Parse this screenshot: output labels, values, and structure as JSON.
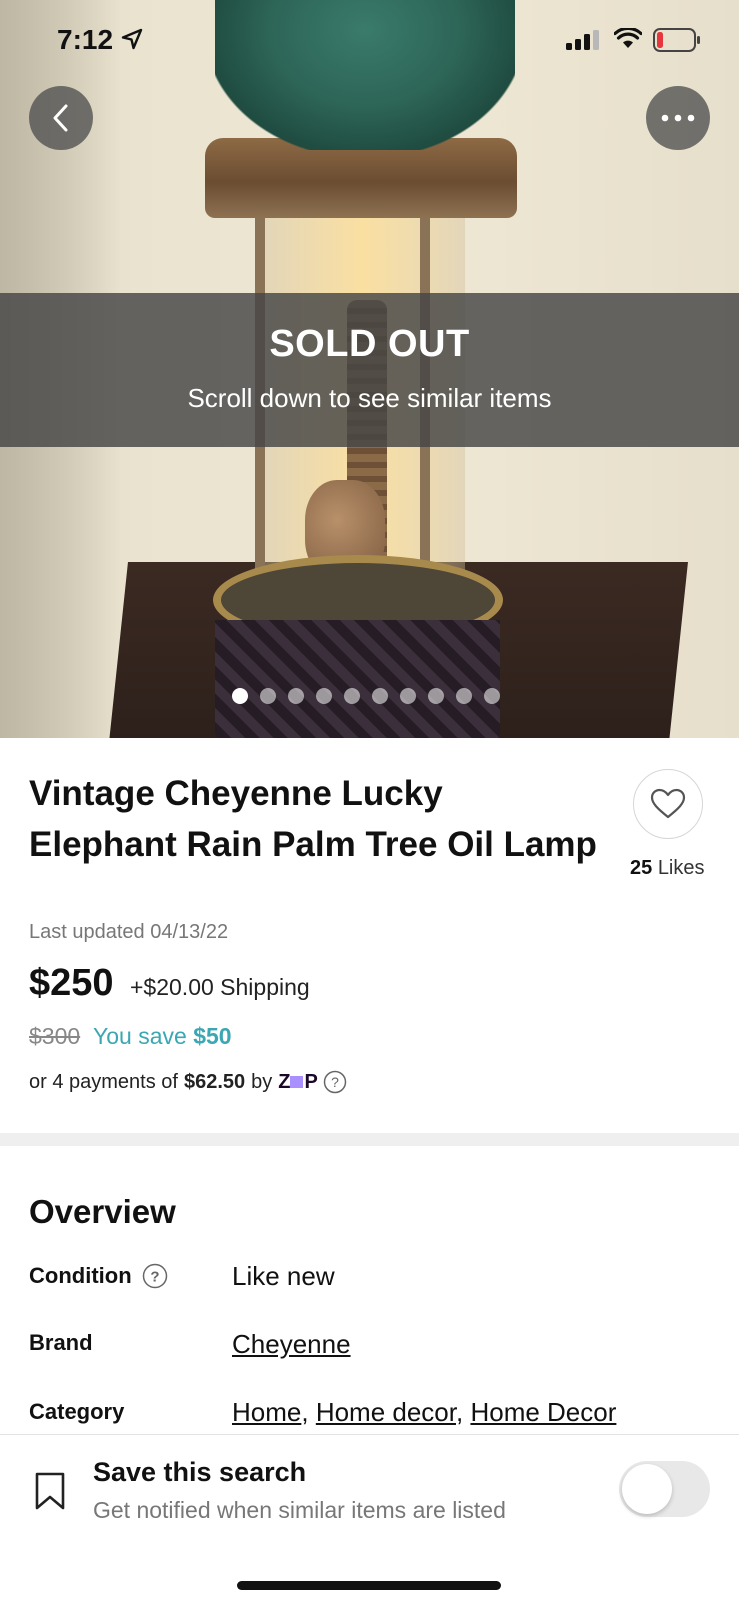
{
  "status_bar": {
    "time": "7:12"
  },
  "hero": {
    "sold_title": "SOLD OUT",
    "sold_subtitle": "Scroll down to see similar items",
    "photo_count": 10,
    "active_photo": 1
  },
  "product": {
    "title": "Vintage Cheyenne Lucky Elephant Rain Palm Tree Oil Lamp",
    "likes_count": "25",
    "likes_label": "Likes",
    "last_updated": "Last updated 04/13/22",
    "price": "$250",
    "shipping": "+$20.00 Shipping",
    "original_price": "$300",
    "you_save_label": "You save",
    "you_save_amount": "$50",
    "installment_prefix": "or 4 payments of",
    "installment_amount": "$62.50",
    "installment_by": "by",
    "installment_provider": "zip"
  },
  "overview": {
    "title": "Overview",
    "condition_label": "Condition",
    "condition_value": "Like new",
    "brand_label": "Brand",
    "brand_value": "Cheyenne",
    "category_label": "Category",
    "categories": [
      "Home",
      "Home decor",
      "Home Decor"
    ]
  },
  "save_search": {
    "title": "Save this search",
    "subtitle": "Get notified when similar items are listed",
    "toggle_on": false
  },
  "colors": {
    "accent_teal": "#3aa7b2",
    "zip_purple": "#aa8fff"
  }
}
